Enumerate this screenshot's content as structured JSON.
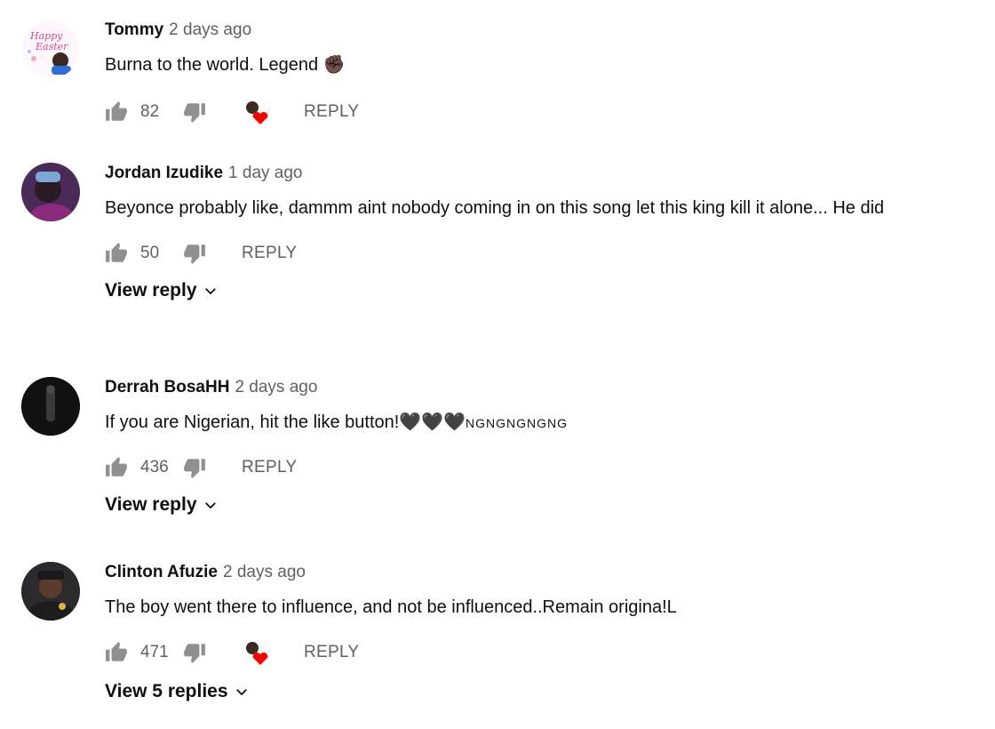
{
  "comments": [
    {
      "author": "Tommy",
      "time": "2 days ago",
      "text": "Burna to the world. Legend ",
      "emoji": "✊🏿",
      "likes": "82",
      "has_creator_heart": true,
      "reply_label": "REPLY",
      "view_replies": ""
    },
    {
      "author": "Jordan Izudike",
      "time": "1 day ago",
      "text": "Beyonce probably like, dammm aint nobody coming in on this song let this king kill it alone... He did",
      "likes": "50",
      "has_creator_heart": false,
      "reply_label": "REPLY",
      "view_replies": "View reply"
    },
    {
      "author": "Derrah BosaHH",
      "time": "2 days ago",
      "text": "If you are Nigerian, hit the like button!🖤🖤🖤",
      "text_suffix": "NGNGNGNGNG",
      "likes": "436",
      "has_creator_heart": false,
      "reply_label": "REPLY",
      "view_replies": "View reply"
    },
    {
      "author": "Clinton Afuzie",
      "time": "2 days ago",
      "text": "The boy went there to influence, and not be influenced..Remain origina!L",
      "likes": "471",
      "has_creator_heart": true,
      "reply_label": "REPLY",
      "view_replies": "View 5 replies"
    }
  ],
  "icons": {
    "like": "thumb-up-icon",
    "dislike": "thumb-down-icon",
    "heart": "creator-heart-icon",
    "chevron": "chevron-down-icon"
  },
  "colors": {
    "heart": "#ff0000",
    "muted": "#606060",
    "text": "#0f0f0f"
  }
}
